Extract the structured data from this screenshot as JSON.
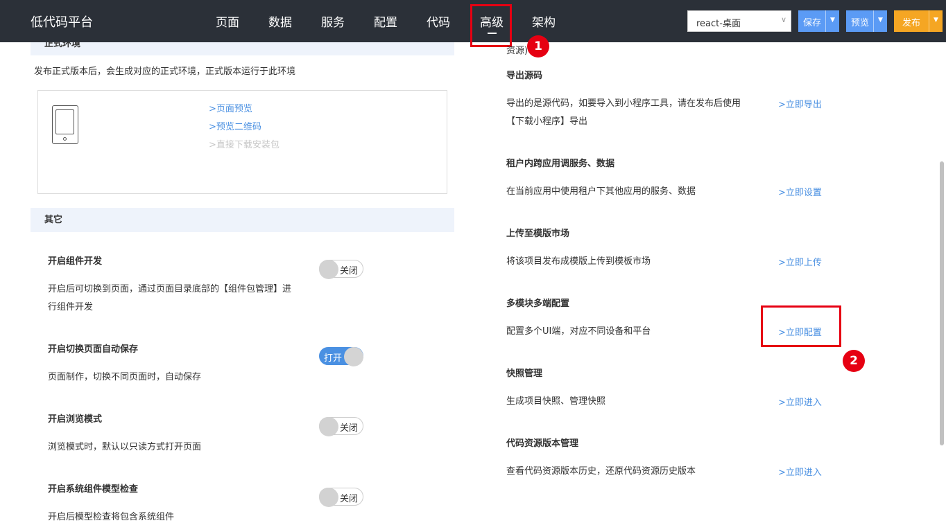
{
  "brand": "低代码平台",
  "nav": {
    "tabs": [
      "页面",
      "数据",
      "服务",
      "配置",
      "代码",
      "高级",
      "架构"
    ],
    "active": "高级"
  },
  "env_select": "react-桌面",
  "buttons": {
    "save": "保存",
    "preview": "预览",
    "publish": "发布"
  },
  "colors": {
    "topbar": "#2b3038",
    "save_btn": "#5b9bf5",
    "preview_btn": "#5b9bf5",
    "publish_btn": "#f5a623",
    "link": "#4a90e2",
    "highlight": "#e60012"
  },
  "annotations": {
    "badge1": "1",
    "badge2": "2"
  },
  "left": {
    "prod_env": {
      "title": "正式环境",
      "desc": "发布正式版本后，会生成对应的正式环境，正式版本运行于此环境",
      "links": [
        "页面预览",
        "预览二维码",
        "直接下载安装包"
      ]
    },
    "other": {
      "title": "其它",
      "settings": [
        {
          "title": "开启组件开发",
          "desc": [
            "开启后可切换到页面，通过页面目录底部的【组件包管理】进",
            "行组件开发"
          ],
          "toggle": "关闭"
        },
        {
          "title": "开启切换页面自动保存",
          "desc": [
            "页面制作，切换不同页面时，自动保存"
          ],
          "toggle": "打开"
        },
        {
          "title": "开启浏览模式",
          "desc": [
            "浏览模式时，默认以只读方式打开页面"
          ],
          "toggle": "关闭"
        },
        {
          "title": "开启系统组件模型检查",
          "desc": [
            "开启后模型检查将包含系统组件"
          ],
          "toggle": "关闭"
        }
      ]
    }
  },
  "right": {
    "top_fragment": "资源)",
    "items": [
      {
        "title": "导出源码",
        "desc": [
          "导出的是源代码，如要导入到小程序工具，请在发布后使用",
          "【下载小程序】导出"
        ],
        "link": "立即导出"
      },
      {
        "title": "租户内跨应用调服务、数据",
        "desc": [
          "在当前应用中使用租户下其他应用的服务、数据"
        ],
        "link": "立即设置"
      },
      {
        "title": "上传至模版市场",
        "desc": [
          "将该项目发布成模版上传到模板市场"
        ],
        "link": "立即上传"
      },
      {
        "title": "多模块多端配置",
        "desc": [
          "配置多个UI端，对应不同设备和平台"
        ],
        "link": "立即配置"
      },
      {
        "title": "快照管理",
        "desc": [
          "生成项目快照、管理快照"
        ],
        "link": "立即进入"
      },
      {
        "title": "代码资源版本管理",
        "desc": [
          "查看代码资源版本历史，还原代码资源历史版本"
        ],
        "link": "立即进入"
      }
    ]
  }
}
